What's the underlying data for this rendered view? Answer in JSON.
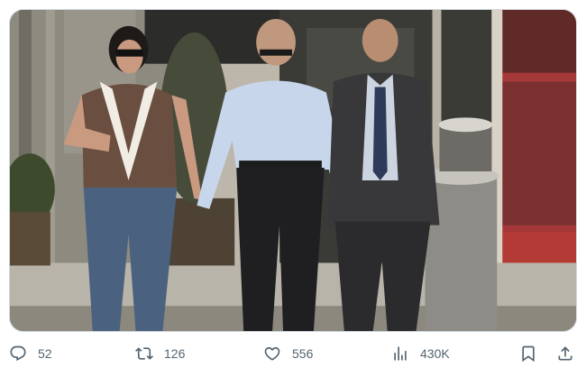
{
  "actions": {
    "reply": {
      "icon": "reply-icon",
      "count": "52"
    },
    "repost": {
      "icon": "repost-icon",
      "count": "126"
    },
    "like": {
      "icon": "like-icon",
      "count": "556"
    },
    "views": {
      "icon": "views-icon",
      "count": "430K"
    },
    "bookmark": {
      "icon": "bookmark-icon"
    },
    "share": {
      "icon": "share-icon"
    }
  },
  "colors": {
    "icon_gray": "#536471",
    "border": "#cfd9de"
  }
}
